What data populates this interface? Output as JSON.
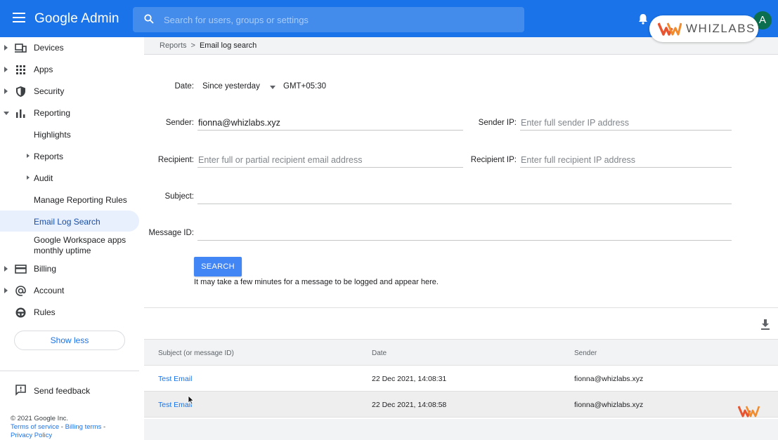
{
  "header": {
    "brand": "Google Admin",
    "search_placeholder": "Search for users, groups or settings",
    "overlay_logo_text": "WHIZLABS",
    "avatar_initial": "A",
    "accent": "#1a73e8"
  },
  "sidebar": {
    "items": [
      {
        "label": "Devices",
        "icon": "devices-icon"
      },
      {
        "label": "Apps",
        "icon": "apps-grid-icon"
      },
      {
        "label": "Security",
        "icon": "shield-icon"
      },
      {
        "label": "Reporting",
        "icon": "bar-chart-icon"
      },
      {
        "label": "Billing",
        "icon": "credit-card-icon"
      },
      {
        "label": "Account",
        "icon": "at-sign-icon"
      },
      {
        "label": "Rules",
        "icon": "steering-icon"
      }
    ],
    "reporting_sub": {
      "highlights": "Highlights",
      "reports": "Reports",
      "audit": "Audit",
      "manage_rules": "Manage Reporting Rules",
      "email_log_search": "Email Log Search",
      "uptime_line1": "Google Workspace apps",
      "uptime_line2": "monthly uptime"
    },
    "show_less": "Show less",
    "send_feedback": "Send feedback",
    "footer": {
      "copyright": "© 2021 Google Inc.",
      "terms": "Terms of service",
      "billing_terms": "Billing terms",
      "privacy": "Privacy Policy"
    }
  },
  "breadcrumb": {
    "parent": "Reports",
    "separator": ">",
    "current": "Email log search"
  },
  "form": {
    "date_label": "Date:",
    "date_value": "Since yesterday",
    "timezone": "GMT+05:30",
    "sender_label": "Sender:",
    "sender_value": "fionna@whizlabs.xyz",
    "sender_ip_label": "Sender IP:",
    "sender_ip_placeholder": "Enter full sender IP address",
    "recipient_label": "Recipient:",
    "recipient_placeholder": "Enter full or partial recipient email address",
    "recipient_ip_label": "Recipient IP:",
    "recipient_ip_placeholder": "Enter full recipient IP address",
    "subject_label": "Subject:",
    "message_id_label": "Message ID:",
    "search_button": "SEARCH",
    "note": "It may take a few minutes for a message to be logged and appear here."
  },
  "results": {
    "columns": [
      "Subject (or message ID)",
      "Date",
      "Sender"
    ],
    "rows": [
      {
        "subject": "Test Email",
        "date": "22 Dec 2021, 14:08:31",
        "sender": "fionna@whizlabs.xyz"
      },
      {
        "subject": "Test Email",
        "date": "22 Dec 2021, 14:08:58",
        "sender": "fionna@whizlabs.xyz"
      }
    ]
  }
}
